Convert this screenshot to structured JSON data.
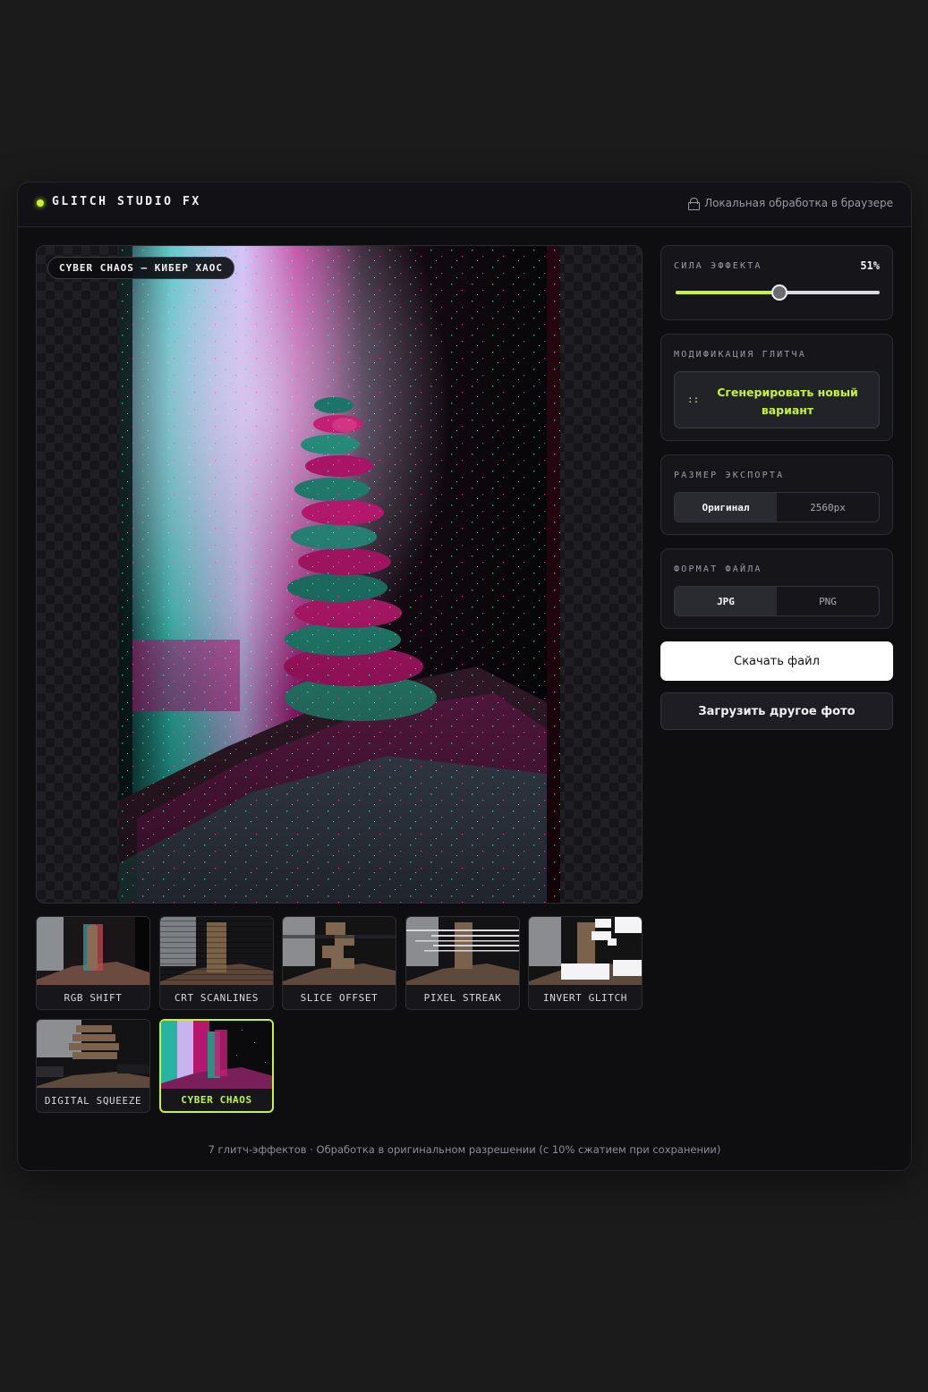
{
  "header": {
    "brand": "GLITCH STUDIO FX",
    "local_processing": "Локальная обработка в браузере"
  },
  "preview": {
    "badge": "CYBER CHAOS — КИБЕР ХАОС"
  },
  "effects": [
    {
      "label": "RGB SHIFT",
      "active": false
    },
    {
      "label": "CRT SCANLINES",
      "active": false
    },
    {
      "label": "SLICE OFFSET",
      "active": false
    },
    {
      "label": "PIXEL STREAK",
      "active": false
    },
    {
      "label": "INVERT GLITCH",
      "active": false
    },
    {
      "label": "DIGITAL SQUEEZE",
      "active": false
    },
    {
      "label": "CYBER CHAOS",
      "active": true
    }
  ],
  "strength": {
    "label": "СИЛА ЭФФЕКТА",
    "value_text": "51%",
    "value": 0.51
  },
  "modification": {
    "label": "МОДИФИКАЦИЯ ГЛИТЧА",
    "icon": "::",
    "generate_line1": "Сгенерировать новый",
    "generate_line2": "вариант"
  },
  "export_size": {
    "label": "РАЗМЕР ЭКСПОРТА",
    "options": [
      "Оригинал",
      "2560px"
    ],
    "selected": "Оригинал"
  },
  "file_format": {
    "label": "ФОРМАТ ФАЙЛА",
    "options": [
      "JPG",
      "PNG"
    ],
    "selected": "JPG"
  },
  "actions": {
    "download": "Скачать файл",
    "upload": "Загрузить другое фото"
  },
  "footer": "7 глитч-эффектов · Обработка в оригинальном разрешении (с 10% сжатием при сохранении)",
  "colors": {
    "accent": "#c6f433",
    "magenta": "#e0117f",
    "teal": "#1fc3a5",
    "background": "#0e0e11"
  }
}
